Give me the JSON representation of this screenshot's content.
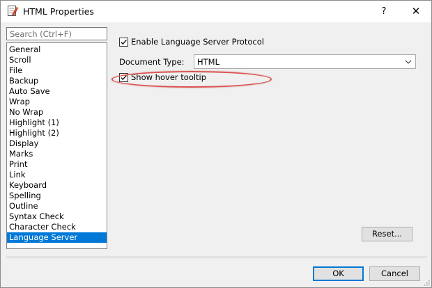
{
  "window": {
    "title": "HTML Properties",
    "help_label": "?",
    "close_label": "✕"
  },
  "search": {
    "placeholder": "Search (Ctrl+F)",
    "value": ""
  },
  "nav": {
    "items": [
      "General",
      "Scroll",
      "File",
      "Backup",
      "Auto Save",
      "Wrap",
      "No Wrap",
      "Highlight (1)",
      "Highlight (2)",
      "Display",
      "Marks",
      "Print",
      "Link",
      "Keyboard",
      "Spelling",
      "Outline",
      "Syntax Check",
      "Character Check",
      "Language Server"
    ],
    "selected": "Language Server"
  },
  "settings": {
    "enable_lsp_label": "Enable Language Server Protocol",
    "enable_lsp_checked": true,
    "document_type_label": "Document Type:",
    "document_type_value": "HTML",
    "show_hover_label": "Show hover tooltip",
    "show_hover_checked": true
  },
  "buttons": {
    "reset": "Reset...",
    "ok": "OK",
    "cancel": "Cancel"
  },
  "colors": {
    "selection": "#0078d7",
    "annotation": "#d9534f",
    "dialog_bg": "#f0f0f0"
  },
  "icons": {
    "app": "document-pencil-icon",
    "checkmark": "checkmark-icon",
    "dropdown": "chevron-down-icon",
    "resize": "resize-grip-icon"
  }
}
